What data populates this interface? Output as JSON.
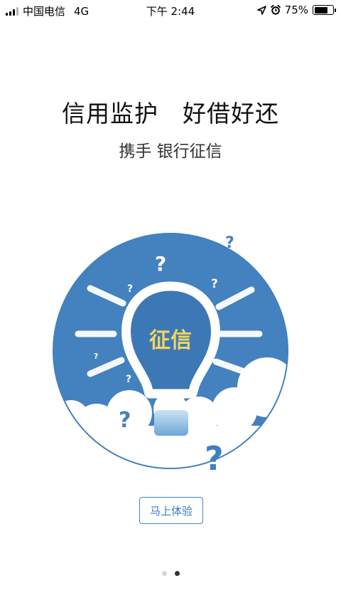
{
  "status_bar": {
    "carrier": "中国电信",
    "network": "4G",
    "time": "下午 2:44",
    "battery_percent": "75%",
    "battery_level": 0.75,
    "icons": [
      "signal-icon",
      "location-arrow-icon",
      "alarm-clock-icon",
      "battery-icon"
    ]
  },
  "onboarding": {
    "headline": "信用监护　好借好还",
    "subline": "携手  银行征信",
    "illustration_label": "征信",
    "illustration_icon": "lightbulb-icon",
    "cta_label": "马上体验"
  },
  "pager": {
    "pages": 2,
    "active_index": 1
  },
  "colors": {
    "circle_blue": "#4381bf",
    "bulb_text_yellow": "#f3d55c",
    "button_blue": "#3d7bbd",
    "cloud_white": "#ffffff"
  }
}
